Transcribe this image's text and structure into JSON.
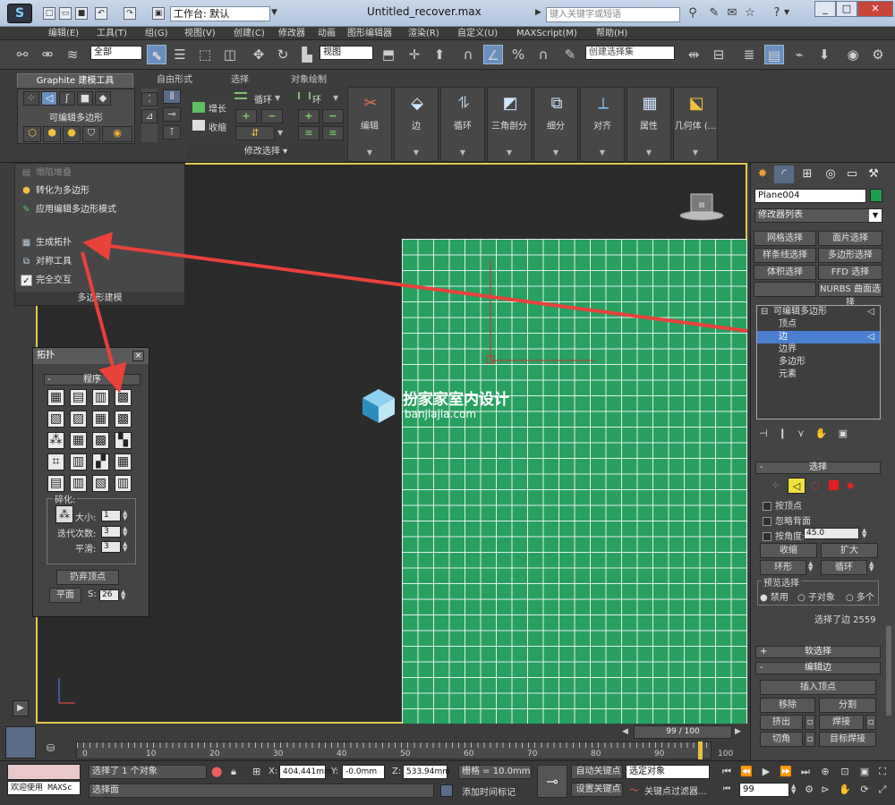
{
  "titlebar": {
    "workspace": "工作台: 默认",
    "title": "Untitled_recover.max",
    "search_placeholder": "键入关键字或短语"
  },
  "menu": [
    "编辑(E)",
    "工具(T)",
    "组(G)",
    "视图(V)",
    "创建(C)",
    "修改器",
    "动画",
    "图形编辑器",
    "渲染(R)",
    "自定义(U)",
    "MAXScript(M)",
    "帮助(H)"
  ],
  "toolbar": {
    "filter": "全部",
    "view": "视图",
    "sel_set_placeholder": "创建选择集"
  },
  "ribbon": {
    "tabs": [
      "Graphite 建模工具",
      "自由形式",
      "选择",
      "对象绘制"
    ],
    "section_label": "可编辑多边形",
    "grow": "增长",
    "shrink": "收缩",
    "loop": "循环",
    "ring": "环",
    "modify_sel": "修改选择",
    "big_buttons": [
      "编辑",
      "边",
      "循环",
      "三角剖分",
      "细分",
      "对齐",
      "属性",
      "几何体 (..."
    ]
  },
  "dropdown": {
    "items": [
      "塌陷堆叠",
      "转化为多边形",
      "应用编辑多边形模式",
      "生成拓扑",
      "对称工具",
      "完全交互"
    ],
    "footer": "多边形建模"
  },
  "topology": {
    "title": "拓扑",
    "group": "程序",
    "subdiv_label": "碎化:",
    "size_label": "大小:",
    "size_value": "1",
    "iter_label": "迭代次数:",
    "iter_value": "3",
    "smooth_label": "平滑:",
    "smooth_value": "3",
    "discard": "扔弃顶点",
    "flat": "平面",
    "s_label": "S:",
    "s_value": "26"
  },
  "watermark": {
    "cn": "扮家家室内设计",
    "url": "banjiajia.com"
  },
  "viewport": {
    "label": ""
  },
  "cmdpanel": {
    "object_name": "Plane004",
    "modlist": "修改器列表",
    "buttons": [
      "网格选择",
      "面片选择",
      "样条线选择",
      "多边形选择",
      "体积选择",
      "FFD 选择",
      "",
      "NURBS 曲面选择"
    ],
    "stack": [
      "可编辑多边形",
      "顶点",
      "边",
      "边界",
      "多边形",
      "元素"
    ],
    "select_header": "选择",
    "by_vertex": "按顶点",
    "ignore_back": "忽略背面",
    "by_angle": "按角度:",
    "angle_value": "45.0",
    "shrink": "收缩",
    "grow": "扩大",
    "ring": "环形",
    "loop": "循环",
    "preview_label": "预览选择",
    "preview_opts": [
      "禁用",
      "子对象",
      "多个"
    ],
    "selected_info": "选择了边 2559",
    "soft_sel": "软选择",
    "edit_edges": "编辑边",
    "insert_vertex": "插入顶点",
    "remove": "移除",
    "split": "分割",
    "extrude": "挤出",
    "weld": "焊接",
    "chamfer": "切角",
    "target_weld": "目标焊接"
  },
  "timeline": {
    "frame": "99 / 100",
    "ticks": [
      "0",
      "10",
      "20",
      "30",
      "40",
      "50",
      "60",
      "70",
      "80",
      "90",
      "100"
    ]
  },
  "status": {
    "welcome": "欢迎使用 MAXSc",
    "selected": "选择了 1 个对象",
    "prompt": "选择面",
    "x_label": "X:",
    "x_value": "404.441mm",
    "y_label": "Y:",
    "y_value": "-0.0mm",
    "z_label": "Z:",
    "z_value": "533.94mm",
    "grid": "栅格 = 10.0mm",
    "add_time_tag": "添加时间标记",
    "auto_key": "自动关键点",
    "set_key": "设置关键点",
    "sel_obj": "选定对象",
    "key_filters": "关键点过滤器...",
    "frame_field": "99"
  },
  "colors": {
    "accent": "#4a7fd0",
    "plane": "#27a060",
    "viewport_border": "#e4c84a",
    "arrow": "#e8423a"
  }
}
